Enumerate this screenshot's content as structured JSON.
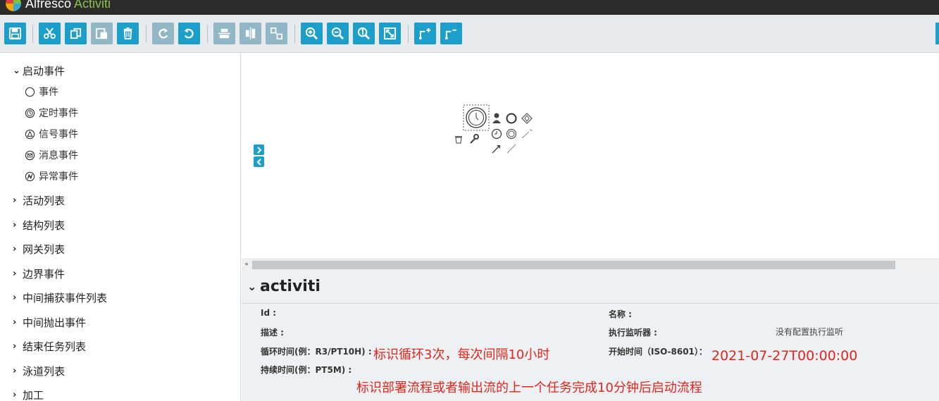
{
  "app": {
    "brand_main": "Alfresco",
    "brand_accent": "Activiti"
  },
  "toolbar": {
    "buttons": [
      {
        "name": "save-button",
        "icon": "save-icon"
      },
      {
        "name": "cut-button",
        "icon": "scissors-icon"
      },
      {
        "name": "copy-button",
        "icon": "copy-icon"
      },
      {
        "name": "paste-button",
        "icon": "paste-icon"
      },
      {
        "name": "delete-button",
        "icon": "trash-icon"
      },
      {
        "name": "redo-button",
        "icon": "redo-icon"
      },
      {
        "name": "undo-button",
        "icon": "undo-icon"
      },
      {
        "name": "align-vertical-button",
        "icon": "align-vertical-icon"
      },
      {
        "name": "align-horizontal-button",
        "icon": "align-horizontal-icon"
      },
      {
        "name": "same-size-button",
        "icon": "same-size-icon"
      },
      {
        "name": "zoom-in-button",
        "icon": "zoom-in-icon"
      },
      {
        "name": "zoom-out-button",
        "icon": "zoom-out-icon"
      },
      {
        "name": "zoom-actual-button",
        "icon": "zoom-actual-icon"
      },
      {
        "name": "zoom-fit-button",
        "icon": "zoom-fit-icon"
      },
      {
        "name": "add-bendpoint-button",
        "icon": "add-bendpoint-icon"
      },
      {
        "name": "remove-bendpoint-button",
        "icon": "remove-bendpoint-icon"
      }
    ]
  },
  "palette": {
    "start_events": {
      "label": "启动事件",
      "items": [
        {
          "label": "事件",
          "icon": "none-start-icon"
        },
        {
          "label": "定时事件",
          "icon": "timer-start-icon"
        },
        {
          "label": "信号事件",
          "icon": "signal-start-icon"
        },
        {
          "label": "消息事件",
          "icon": "message-start-icon"
        },
        {
          "label": "异常事件",
          "icon": "error-start-icon"
        }
      ]
    },
    "groups": [
      "活动列表",
      "结构列表",
      "网关列表",
      "边界事件",
      "中间捕获事件列表",
      "中间抛出事件",
      "结束任务列表",
      "泳道列表",
      "加工"
    ]
  },
  "properties": {
    "title": "activiti",
    "fields": {
      "id_label": "Id :",
      "name_label": "名称 :",
      "description_label": "描述 :",
      "listeners_label": "执行监听器 :",
      "listeners_value": "没有配置执行监听",
      "cycle_label": "循环时间(例：R3/PT10H) :",
      "start_time_label": "开始时间（ISO-8601）：",
      "duration_label": "持续时间(例：PT5M) :"
    },
    "annotations": {
      "cycle_note": "标识循环3次，每次间隔10小时",
      "start_time_value": "2021-07-27T00:00:00",
      "duration_note": "标识部署流程或者输出流的上一个任务完成10分钟后启动流程"
    }
  },
  "colors": {
    "accent": "#1b9ec9",
    "disabled": "#91b6c5",
    "annotation": "#e0251b"
  }
}
